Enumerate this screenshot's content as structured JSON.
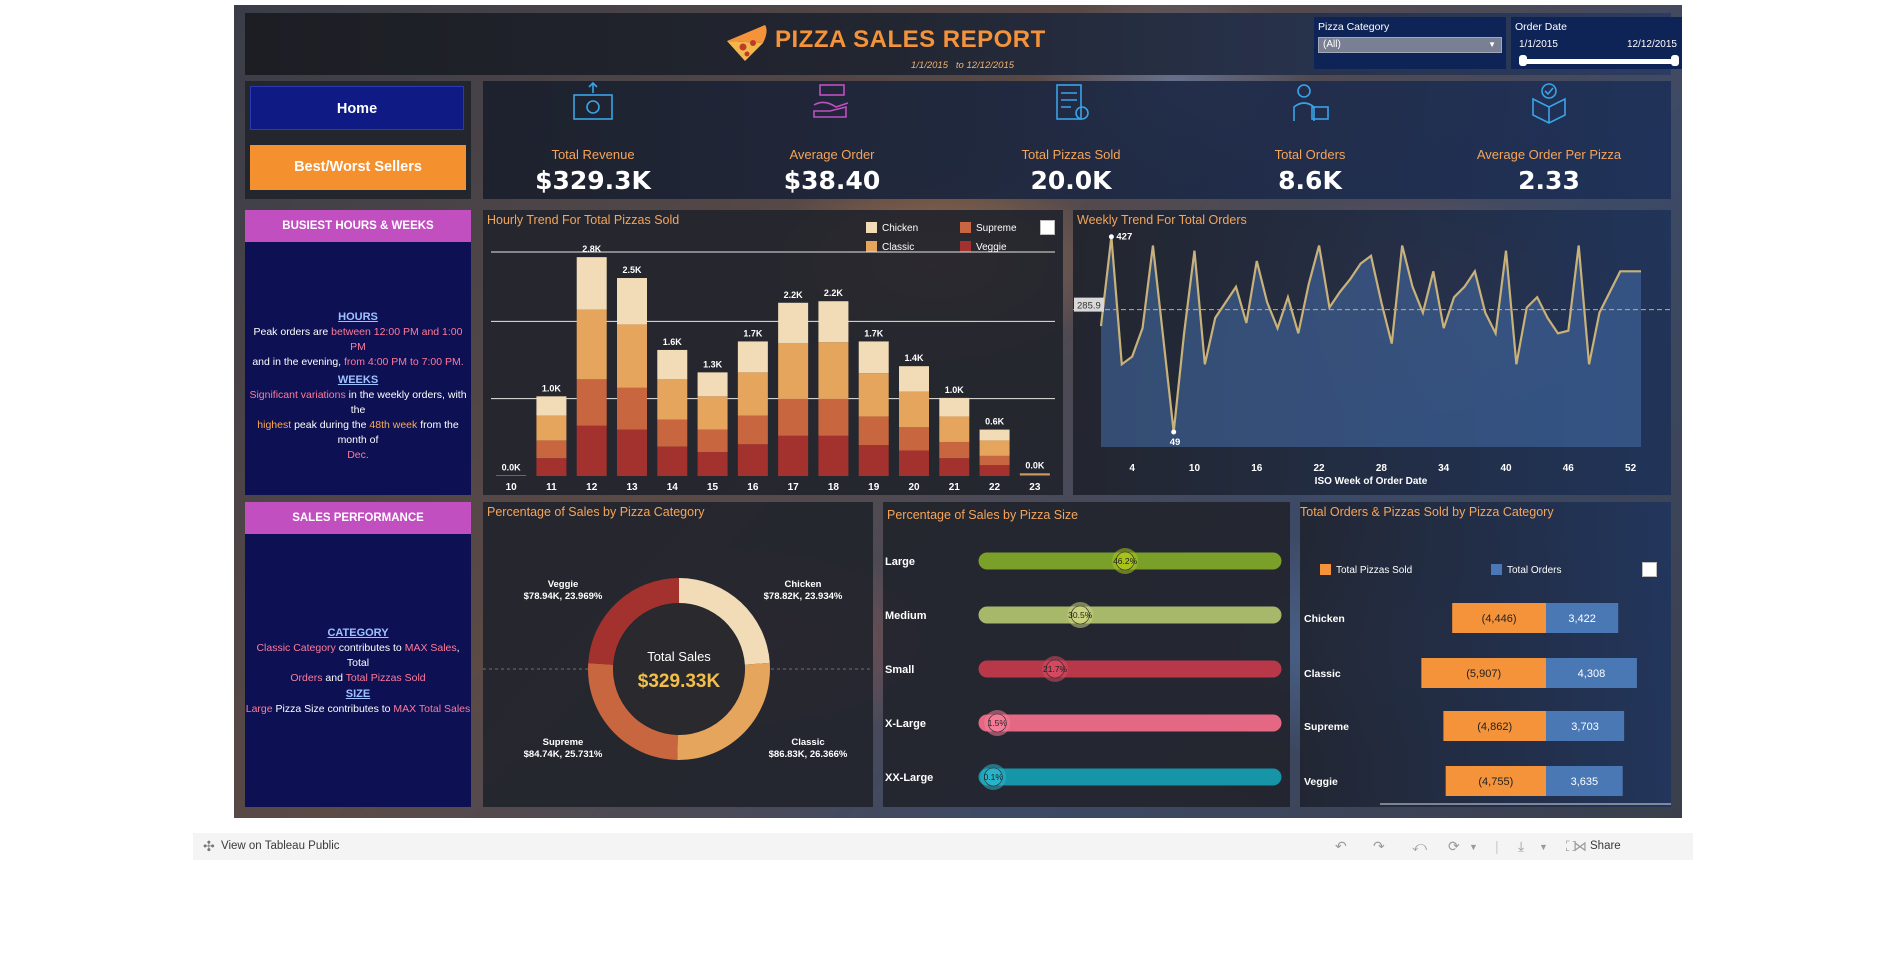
{
  "header": {
    "title": "PIZZA SALES REPORT",
    "date_from": "1/1/2015",
    "date_to": "to 12/12/2015",
    "category_filter": {
      "label": "Pizza Category",
      "value": "(All)"
    },
    "date_filter": {
      "label": "Order Date",
      "start": "1/1/2015",
      "end": "12/12/2015"
    }
  },
  "nav": {
    "home": "Home",
    "best_worst": "Best/Worst Sellers"
  },
  "kpis": [
    {
      "label": "Total Revenue",
      "value": "$329.3K",
      "icon": "money-hand-icon"
    },
    {
      "label": "Average Order",
      "value": "$38.40",
      "icon": "pizza-box-icon"
    },
    {
      "label": "Total Pizzas Sold",
      "value": "20.0K",
      "icon": "checklist-icon"
    },
    {
      "label": "Total Orders",
      "value": "8.6K",
      "icon": "delivery-person-icon"
    },
    {
      "label": "Average Order Per Pizza",
      "value": "2.33",
      "icon": "package-check-icon"
    }
  ],
  "busiest": {
    "title": "BUSIEST HOURS & WEEKS",
    "hours_heading": "HOURS",
    "hours_1": "Peak orders are",
    "hours_2": "between 12:00 PM and 1:00 PM",
    "hours_3": "and in the evening,",
    "hours_4": "from 4:00 PM to 7:00 PM.",
    "weeks_heading": "WEEKS",
    "weeks_1": "Significant variations",
    "weeks_2": "in the weekly orders, with the",
    "weeks_3": "highest",
    "weeks_4": "peak during the",
    "weeks_5": "48th week",
    "weeks_6": "from the month of",
    "weeks_7": "Dec."
  },
  "performance": {
    "title": "SALES PERFORMANCE",
    "cat_heading": "CATEGORY",
    "cat_1": "Classic Category",
    "cat_2": "contributes to",
    "cat_3": "MAX Sales",
    "cat_4": ", Total",
    "cat_5": "Orders",
    "cat_6": "and",
    "cat_7": "Total Pizzas Sold",
    "size_heading": "SIZE",
    "size_1": "Large",
    "size_2": "Pizza Size contributes to",
    "size_3": "MAX Total Sales"
  },
  "colors": {
    "chicken": "#f2dcb8",
    "classic": "#e5a55c",
    "supreme": "#c8673f",
    "veggie": "#a3312e",
    "accent_orange": "#f5933a",
    "bar_orders": "#4a78b5"
  },
  "chart_data": [
    {
      "type": "bar",
      "title": "Hourly Trend For Total Pizzas Sold",
      "stacked": true,
      "categories": [
        "10",
        "11",
        "12",
        "13",
        "14",
        "15",
        "16",
        "17",
        "18",
        "19",
        "20",
        "21",
        "22",
        "23"
      ],
      "totals_labels": [
        "0.0K",
        "1.0K",
        "2.8K",
        "2.5K",
        "1.6K",
        "1.3K",
        "1.7K",
        "2.2K",
        "2.2K",
        "1.7K",
        "1.4K",
        "1.0K",
        "0.6K",
        "0.0K"
      ],
      "series": [
        {
          "name": "Chicken",
          "values": [
            2,
            250,
            680,
            600,
            380,
            310,
            400,
            520,
            530,
            410,
            330,
            240,
            140,
            7
          ]
        },
        {
          "name": "Classic",
          "values": [
            3,
            320,
            900,
            820,
            520,
            430,
            560,
            720,
            730,
            560,
            460,
            330,
            200,
            11
          ]
        },
        {
          "name": "Supreme",
          "values": [
            2,
            230,
            600,
            540,
            350,
            290,
            370,
            480,
            480,
            370,
            300,
            210,
            120,
            7
          ]
        },
        {
          "name": "Veggie",
          "values": [
            1,
            230,
            650,
            600,
            380,
            310,
            410,
            520,
            520,
            400,
            330,
            230,
            140,
            7
          ]
        }
      ],
      "legend": "top-right"
    },
    {
      "type": "area",
      "title": "Weekly Trend For Total Orders",
      "xlabel": "ISO Week of Order Date",
      "x_ticks": [
        4,
        10,
        16,
        22,
        28,
        34,
        40,
        46,
        52
      ],
      "x": [
        1,
        2,
        3,
        4,
        5,
        6,
        7,
        8,
        9,
        10,
        11,
        12,
        13,
        14,
        15,
        16,
        17,
        18,
        19,
        20,
        21,
        22,
        23,
        24,
        25,
        26,
        27,
        28,
        29,
        30,
        31,
        32,
        33,
        34,
        35,
        36,
        37,
        38,
        39,
        40,
        41,
        42,
        43,
        44,
        45,
        46,
        47,
        48,
        49,
        50,
        51,
        52,
        53
      ],
      "values": [
        254,
        427,
        180,
        195,
        250,
        410,
        230,
        49,
        240,
        400,
        180,
        270,
        300,
        330,
        260,
        380,
        300,
        250,
        310,
        240,
        335,
        410,
        290,
        320,
        345,
        375,
        390,
        300,
        220,
        410,
        330,
        280,
        360,
        250,
        310,
        330,
        360,
        280,
        240,
        400,
        180,
        290,
        310,
        270,
        240,
        245,
        410,
        180,
        280,
        320,
        360,
        360,
        360
      ],
      "annotations": {
        "max_label": "427",
        "min_label": "49",
        "average_label": "285.9"
      },
      "average": 285.9
    },
    {
      "type": "pie",
      "title": "Percentage of Sales by Pizza Category",
      "center_label": "Total Sales",
      "center_value": "$329.33K",
      "slices": [
        {
          "name": "Chicken",
          "value": 23.934,
          "label": "$78.82K, 23.934%"
        },
        {
          "name": "Classic",
          "value": 26.366,
          "label": "$86.83K, 26.366%"
        },
        {
          "name": "Supreme",
          "value": 25.731,
          "label": "$84.74K, 25.731%"
        },
        {
          "name": "Veggie",
          "value": 23.969,
          "label": "$78.94K, 23.969%"
        }
      ]
    },
    {
      "type": "bar",
      "title": "Percentage of Sales by Pizza Size",
      "categories": [
        "Large",
        "Medium",
        "Small",
        "X-Large",
        "XX-Large"
      ],
      "values": [
        46.2,
        30.5,
        21.7,
        1.5,
        0.1
      ],
      "value_labels": [
        "46.2%",
        "30.5%",
        "21.7%",
        "1.5%",
        "0.1%"
      ],
      "xlim": [
        0,
        100
      ]
    },
    {
      "type": "bar",
      "title": "Total Orders & Pizzas Sold by Pizza Category",
      "categories": [
        "Chicken",
        "Classic",
        "Supreme",
        "Veggie"
      ],
      "series": [
        {
          "name": "Total Pizzas Sold",
          "values": [
            4446,
            5907,
            4862,
            4755
          ],
          "labels": [
            "(4,446)",
            "(5,907)",
            "(4,862)",
            "(4,755)"
          ]
        },
        {
          "name": "Total Orders",
          "values": [
            3422,
            4308,
            3703,
            3635
          ],
          "labels": [
            "3,422",
            "4,308",
            "3,703",
            "3,635"
          ]
        }
      ],
      "legend": "top"
    }
  ],
  "footer": {
    "view_link": "View on Tableau Public",
    "share": "Share"
  }
}
